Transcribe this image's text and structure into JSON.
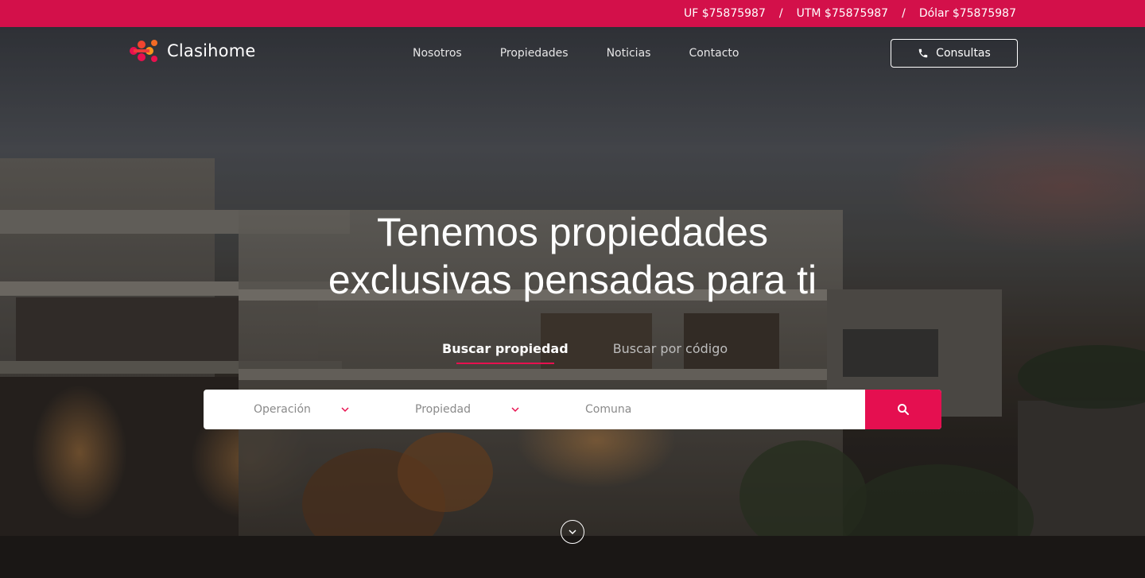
{
  "rates": {
    "uf": "UF $75875987",
    "utm": "UTM $75875987",
    "dolar": "Dólar $75875987",
    "separator": "/"
  },
  "brand": {
    "name": "Clasihome",
    "accent": "#e50f50",
    "topbar_color": "#d3104a"
  },
  "nav": {
    "items": [
      {
        "label": "Nosotros"
      },
      {
        "label": "Propiedades"
      },
      {
        "label": "Noticias"
      },
      {
        "label": "Contacto"
      }
    ],
    "cta_label": "Consultas",
    "cta_icon": "phone-icon"
  },
  "hero": {
    "line1": "Tenemos propiedades",
    "line2": "exclusivas pensadas para ti"
  },
  "search": {
    "tabs": [
      {
        "label": "Buscar propiedad",
        "active": true
      },
      {
        "label": "Buscar por código",
        "active": false
      }
    ],
    "operation_placeholder": "Operación",
    "property_placeholder": "Propiedad",
    "comuna_placeholder": "Comuna",
    "button_icon": "search-icon"
  },
  "scroll_icon": "chevron-down-circle-icon"
}
